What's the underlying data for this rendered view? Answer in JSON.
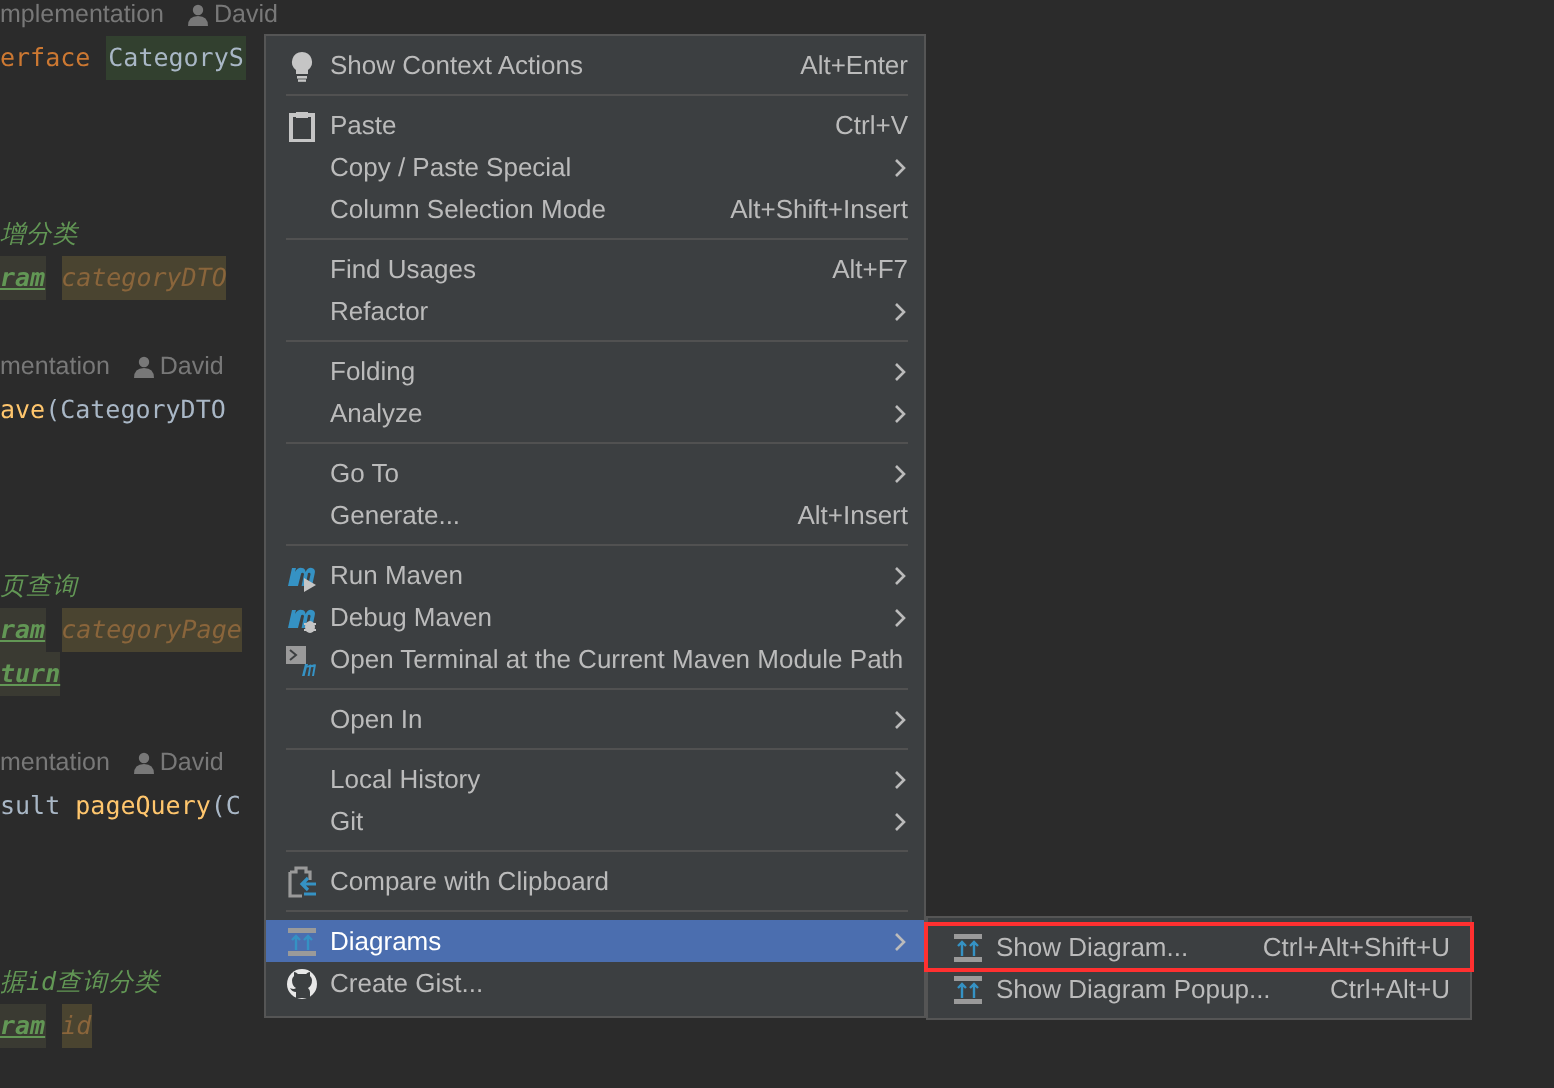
{
  "editor": {
    "lines": [
      {
        "segments": [
          {
            "text": "mplementation",
            "kind": "hint"
          },
          {
            "text": "David",
            "kind": "author"
          }
        ]
      },
      {
        "segments": [
          {
            "text": "erface",
            "kind": "keyword"
          },
          {
            "text": "CategoryS",
            "kind": "match"
          }
        ]
      },
      {
        "kind": "blank"
      },
      {
        "kind": "blank"
      },
      {
        "kind": "blank"
      },
      {
        "segments": [
          {
            "text": "增分类",
            "kind": "comment"
          }
        ]
      },
      {
        "segments": [
          {
            "text": "ram",
            "kind": "doctag"
          },
          {
            "text": "categoryDTO",
            "kind": "param"
          }
        ]
      },
      {
        "kind": "blank"
      },
      {
        "segments": [
          {
            "text": "mentation",
            "kind": "hint"
          },
          {
            "text": "David",
            "kind": "author"
          }
        ]
      },
      {
        "segments": [
          {
            "text": "ave",
            "kind": "method"
          },
          {
            "text": "(CategoryDTO",
            "kind": "plain"
          }
        ]
      },
      {
        "kind": "blank"
      },
      {
        "kind": "blank"
      },
      {
        "kind": "blank"
      },
      {
        "segments": [
          {
            "text": "页查询",
            "kind": "comment"
          }
        ]
      },
      {
        "segments": [
          {
            "text": "ram",
            "kind": "doctag"
          },
          {
            "text": "categoryPage",
            "kind": "param"
          }
        ]
      },
      {
        "segments": [
          {
            "text": "turn",
            "kind": "doctag"
          }
        ]
      },
      {
        "kind": "blank"
      },
      {
        "segments": [
          {
            "text": "mentation",
            "kind": "hint"
          },
          {
            "text": "David",
            "kind": "author"
          }
        ]
      },
      {
        "segments": [
          {
            "text": "sult ",
            "kind": "plain"
          },
          {
            "text": "pageQuery",
            "kind": "method"
          },
          {
            "text": "(C",
            "kind": "plain"
          }
        ]
      },
      {
        "kind": "blank"
      },
      {
        "kind": "blank"
      },
      {
        "kind": "blank"
      },
      {
        "segments": [
          {
            "text": "据id查询分类",
            "kind": "comment"
          }
        ]
      },
      {
        "segments": [
          {
            "text": "ram",
            "kind": "doctag"
          },
          {
            "text": "id",
            "kind": "param"
          }
        ]
      }
    ]
  },
  "context_menu": {
    "groups": [
      {
        "items": [
          {
            "kind": "bulb",
            "label": "Show Context Actions",
            "shortcut": "Alt+Enter",
            "submenu": false,
            "selected": false
          }
        ]
      },
      {
        "items": [
          {
            "kind": "clipboard",
            "label": "Paste",
            "shortcut": "Ctrl+V",
            "submenu": false,
            "selected": false
          },
          {
            "label": "Copy / Paste Special",
            "submenu": true,
            "selected": false
          },
          {
            "label": "Column Selection Mode",
            "shortcut": "Alt+Shift+Insert",
            "submenu": false,
            "selected": false
          }
        ]
      },
      {
        "items": [
          {
            "label": "Find Usages",
            "shortcut": "Alt+F7",
            "submenu": false,
            "selected": false
          },
          {
            "label": "Refactor",
            "submenu": true,
            "selected": false
          }
        ]
      },
      {
        "items": [
          {
            "label": "Folding",
            "submenu": true,
            "selected": false
          },
          {
            "label": "Analyze",
            "submenu": true,
            "selected": false
          }
        ]
      },
      {
        "items": [
          {
            "label": "Go To",
            "submenu": true,
            "selected": false
          },
          {
            "label": "Generate...",
            "shortcut": "Alt+Insert",
            "submenu": false,
            "selected": false
          }
        ]
      },
      {
        "items": [
          {
            "kind": "maven-run",
            "label": "Run Maven",
            "submenu": true,
            "selected": false
          },
          {
            "kind": "maven-debug",
            "label": "Debug Maven",
            "submenu": true,
            "selected": false
          },
          {
            "kind": "terminal",
            "label": "Open Terminal at the Current Maven Module Path",
            "submenu": false,
            "selected": false
          }
        ]
      },
      {
        "items": [
          {
            "label": "Open In",
            "submenu": true,
            "selected": false
          }
        ]
      },
      {
        "items": [
          {
            "label": "Local History",
            "submenu": true,
            "selected": false
          },
          {
            "label": "Git",
            "submenu": true,
            "selected": false
          }
        ]
      },
      {
        "items": [
          {
            "kind": "compare",
            "label": "Compare with Clipboard",
            "submenu": false,
            "selected": false
          }
        ]
      },
      {
        "items": [
          {
            "kind": "diagram",
            "label": "Diagrams",
            "submenu": true,
            "selected": true
          },
          {
            "kind": "github",
            "label": "Create Gist...",
            "submenu": false,
            "selected": false
          }
        ]
      }
    ]
  },
  "submenu": {
    "items": [
      {
        "kind": "diagram",
        "label": "Show Diagram...",
        "shortcut": "Ctrl+Alt+Shift+U",
        "annotated": true
      },
      {
        "kind": "diagram",
        "label": "Show Diagram Popup...",
        "shortcut": "Ctrl+Alt+U",
        "annotated": false
      }
    ]
  }
}
